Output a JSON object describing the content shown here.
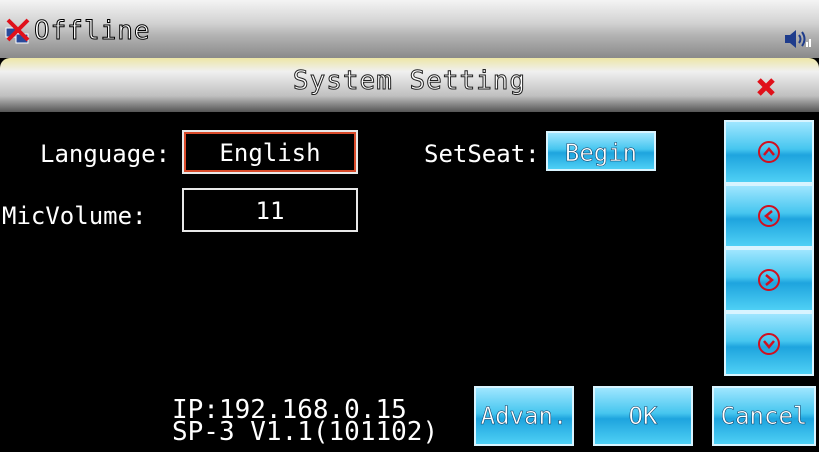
{
  "statusbar": {
    "network_icon": "network-offline-icon",
    "status_text": "Offline",
    "speaker_icon": "speaker-icon"
  },
  "title": {
    "text": "System Setting",
    "close_icon": "close-icon"
  },
  "settings": {
    "language_label": "Language:",
    "language_value": "English",
    "setseat_label": "SetSeat:",
    "setseat_button": "Begin",
    "micvolume_label": "MicVolume:",
    "micvolume_value": "11"
  },
  "nav_buttons": [
    "arrow-up-icon",
    "arrow-left-icon",
    "arrow-right-icon",
    "arrow-down-icon"
  ],
  "info": {
    "ip": "IP:192.168.0.15",
    "version": "SP-3 V1.1(101102)"
  },
  "actions": {
    "advanced": "Advan.",
    "ok": "OK",
    "cancel": "Cancel"
  },
  "colors": {
    "button_cyan": "#46c6ef",
    "focus_border": "#d84a2a",
    "close_red": "#e0101a"
  }
}
